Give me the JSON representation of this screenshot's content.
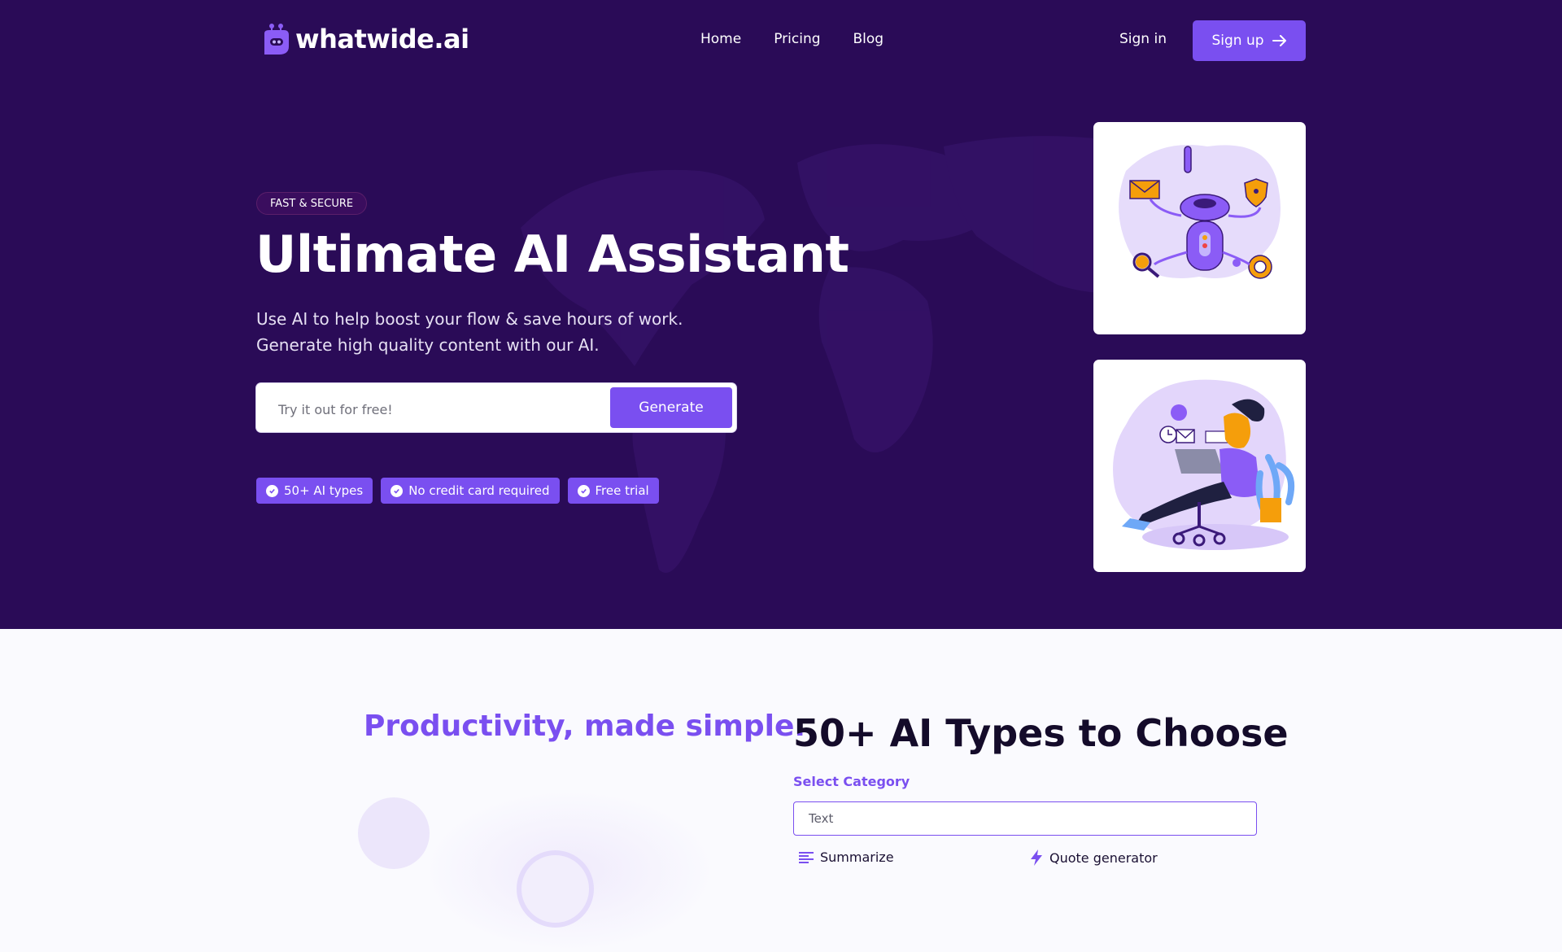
{
  "brand": {
    "name": "whatwide.ai"
  },
  "nav": {
    "links": [
      "Home",
      "Pricing",
      "Blog"
    ],
    "signin": "Sign in",
    "signup": "Sign up"
  },
  "hero": {
    "badge": "FAST & SECURE",
    "title": "Ultimate AI Assistant",
    "subtitle": "Use AI to help boost your flow & save hours of work. Generate high quality content with our AI.",
    "input_placeholder": "Try it out for free!",
    "generate_label": "Generate",
    "features": [
      "50+ AI types",
      "No credit card required",
      "Free trial"
    ]
  },
  "section": {
    "productivity_title": "Productivity, made simple.",
    "types_title": "50+ AI Types to Choose",
    "select_label": "Select Category",
    "select_value": "Text",
    "options": [
      "Summarize",
      "Quote generator"
    ]
  },
  "colors": {
    "hero_bg": "#2a0b57",
    "accent": "#7a4ff0",
    "page_bg": "#fafafe"
  },
  "icons": [
    "robot-logo-icon",
    "arrow-right-icon",
    "check-circle-icon",
    "lines-icon",
    "bolt-icon"
  ]
}
